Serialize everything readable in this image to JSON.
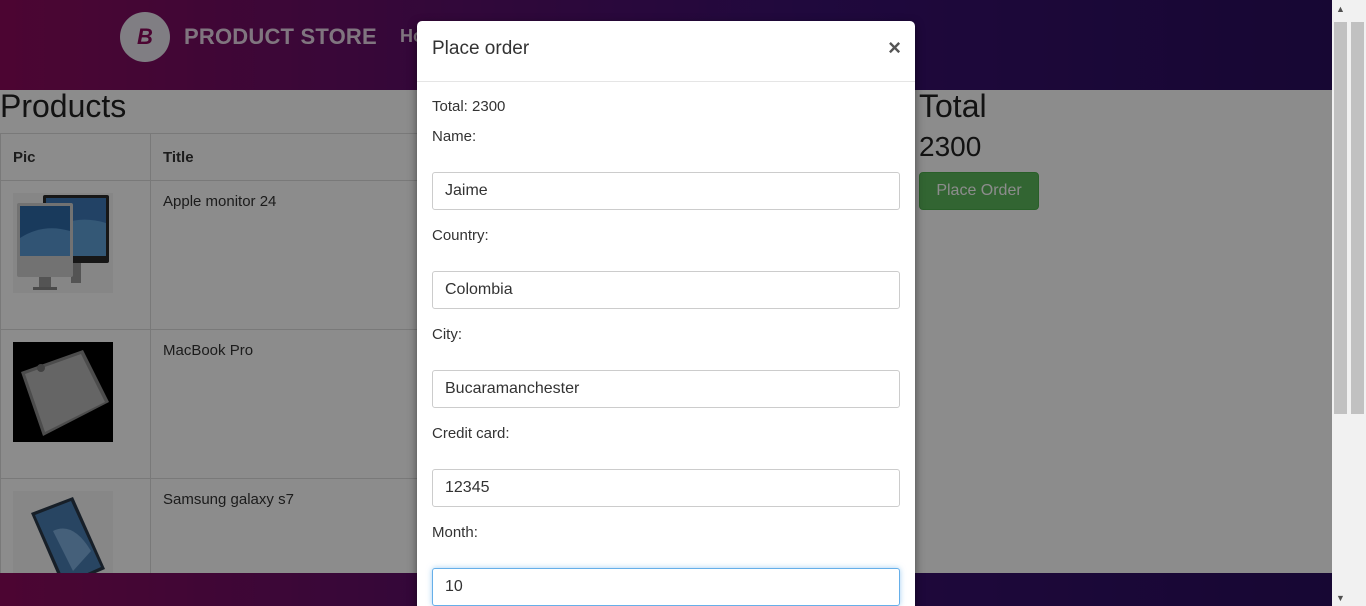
{
  "navbar": {
    "brand_name": "PRODUCT STORE",
    "brand_logo_letter": "B",
    "home_label": "Ho"
  },
  "products": {
    "heading": "Products",
    "columns": [
      "Pic",
      "Title"
    ],
    "rows": [
      {
        "title": "Apple monitor 24",
        "pic": "apple-monitor-image"
      },
      {
        "title": "MacBook Pro",
        "pic": "macbook-image"
      },
      {
        "title": "Samsung galaxy s7",
        "pic": "phone-image"
      }
    ]
  },
  "summary": {
    "total_heading": "Total",
    "total_value": "2300",
    "place_order_label": "Place Order"
  },
  "modal": {
    "title": "Place order",
    "close_label": "×",
    "total_text": "Total: 2300",
    "fields": {
      "name": {
        "label": "Name:",
        "value": "Jaime"
      },
      "country": {
        "label": "Country:",
        "value": "Colombia"
      },
      "city": {
        "label": "City:",
        "value": "Bucaramanchester"
      },
      "card": {
        "label": "Credit card:",
        "value": "12345"
      },
      "month": {
        "label": "Month:",
        "value": "10"
      }
    }
  },
  "colors": {
    "navbar_start": "#8b0a5c",
    "navbar_end": "#2a0d5e",
    "success_button": "#5cb85c",
    "focus_border": "#66afe9"
  }
}
